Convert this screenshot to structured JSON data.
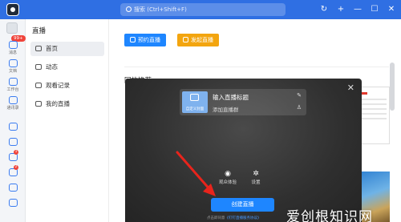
{
  "titlebar": {
    "search_placeholder": "搜索 (Ctrl+Shift+F)",
    "icons": [
      "history-icon",
      "add-icon",
      "minimize-icon",
      "maximize-icon",
      "close-icon"
    ],
    "glyphs": {
      "history": "↻",
      "add": "+",
      "minimize": "—",
      "maximize": "☐",
      "close": "✕"
    }
  },
  "rail": {
    "badge": "99+",
    "items": [
      {
        "label": "消息",
        "icon": "message-icon"
      },
      {
        "label": "文档",
        "icon": "doc-icon"
      },
      {
        "label": "工作台",
        "icon": "workbench-icon"
      },
      {
        "label": "通讯录",
        "icon": "contacts-icon"
      },
      {
        "label": "",
        "icon": "calendar-icon"
      },
      {
        "label": "",
        "icon": "mail-icon"
      },
      {
        "label": "",
        "icon": "approval-icon"
      },
      {
        "label": "",
        "icon": "meeting-icon"
      },
      {
        "label": "",
        "icon": "cube-icon"
      },
      {
        "label": "",
        "icon": "more-icon"
      }
    ],
    "dots": [
      "1",
      "2"
    ]
  },
  "sidebar": {
    "title": "直播",
    "items": [
      {
        "label": "首页",
        "active": true
      },
      {
        "label": "动态",
        "active": false
      },
      {
        "label": "观看记录",
        "active": false
      },
      {
        "label": "我的直播",
        "active": false
      }
    ]
  },
  "main": {
    "btn_reserve": "预约直播",
    "btn_start": "发起直播",
    "section_title": "回放推荐"
  },
  "modal": {
    "close": "✕",
    "cover_label": "自定义封面",
    "title_placeholder": "输入直播标题",
    "add_cover": "添加直播群",
    "option1": "观众体验",
    "option2": "设置",
    "create_button": "创建直播",
    "footer_text": "点击即同意",
    "footer_link": "《钉钉直播服务协议》"
  },
  "watermark": "爱创根知识网",
  "colors": {
    "titlebar": "#2f6fe3",
    "primary": "#1e86ff",
    "orange": "#f3a50f",
    "arrow": "#e8241c"
  }
}
